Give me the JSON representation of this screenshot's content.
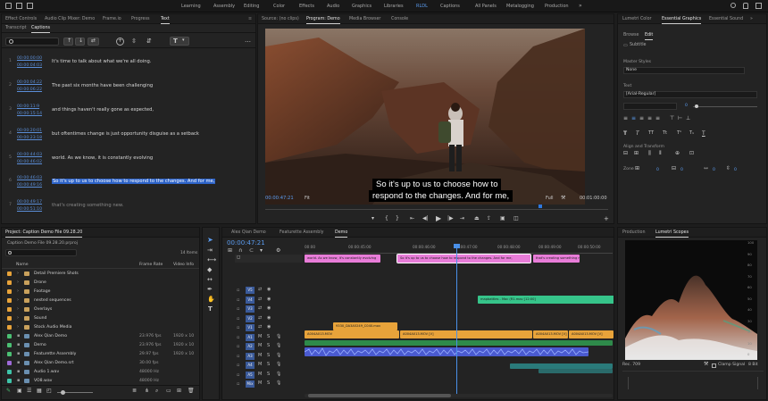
{
  "workspaces": {
    "items": [
      "Learning",
      "Assembly",
      "Editing",
      "Color",
      "Effects",
      "Audio",
      "Graphics",
      "Libraries",
      "RLDL",
      "Libraries",
      "Captions",
      "All Panels",
      "Metalogging",
      "Production"
    ],
    "active_index": 8
  },
  "text_panel": {
    "top_tabs": [
      "Effect Controls",
      "Audio Clip Mixer: Demo",
      "Frame.io",
      "Progress",
      "Text"
    ],
    "active_tab": "Text",
    "sub_tabs": [
      "Transcript",
      "Captions"
    ],
    "active_sub_tab": "Captions",
    "search_placeholder": "",
    "captions": [
      {
        "in": "00:00:00:00",
        "out": "00:00:04:03",
        "text": "It's time to talk about what we're all doing."
      },
      {
        "in": "00:00:04:22",
        "out": "00:00:06:22",
        "text": "The past six months have been challenging"
      },
      {
        "in": "00:00:11:9",
        "out": "00:00:15:14",
        "text": "and things haven't really gone as expected,"
      },
      {
        "in": "00:00:20:01",
        "out": "00:00:23:18",
        "text": "but oftentimes change is just opportunity disguise as a setback"
      },
      {
        "in": "00:00:44:03",
        "out": "00:00:46:02",
        "text": "world. As we know, it is constantly evolving"
      },
      {
        "in": "00:00:46:03",
        "out": "00:00:49:16",
        "text": "So it's up to us to choose how to respond to the changes. And for me,"
      },
      {
        "in": "00:00:49:17",
        "out": "00:00:51:10",
        "text": "that's creating something new."
      }
    ],
    "selected_index": 5
  },
  "source_panel": {
    "tabs": [
      "Source: (no clips)",
      "Program: Demo",
      "Media Browser",
      "Console"
    ],
    "active_tab": "Program: Demo",
    "timecode": "00:00:47:21",
    "fit": "Fit",
    "quality": "Full",
    "duration": "00:01:00:00",
    "caption_line1": "So it's up to us to choose how to",
    "caption_line2": "respond to the changes. And for me,"
  },
  "right_panel": {
    "tabs": [
      "Lumetri Color",
      "Essential Graphics",
      "Essential Sound"
    ],
    "active_tab": "Essential Graphics",
    "sub_tabs": [
      "Browse",
      "Edit"
    ],
    "active_sub_tab": "Edit",
    "layer_name": "Subtitle",
    "master_styles_label": "Master Styles",
    "master_style_value": "None",
    "text_label": "Text",
    "font_value": "[Arial-Regular]",
    "tracking_value": "0",
    "align_label": "Align and Transform",
    "zone_label": "Zone",
    "zone_x": "0",
    "zone_y": "0",
    "zone_w": "0",
    "zone_h": "0"
  },
  "project_panel": {
    "title": "Project: Caption Demo File 09.28.20",
    "file_name": "Caption Demo File 09.28.20.prproj",
    "item_count": "14 Items",
    "columns": [
      "Name",
      "Frame Rate",
      "Video Info"
    ],
    "items": [
      {
        "name": "Detail Premiere Shots",
        "rate": "",
        "info": "",
        "color": "#e8a33a"
      },
      {
        "name": "Drone",
        "rate": "",
        "info": "",
        "color": "#e8a33a"
      },
      {
        "name": "Footage",
        "rate": "",
        "info": "",
        "color": "#e8a33a"
      },
      {
        "name": "nested sequences",
        "rate": "",
        "info": "",
        "color": "#e8a33a"
      },
      {
        "name": "Overlays",
        "rate": "",
        "info": "",
        "color": "#e8a33a"
      },
      {
        "name": "Sound",
        "rate": "",
        "info": "",
        "color": "#e8a33a"
      },
      {
        "name": "Stock Audio Media",
        "rate": "",
        "info": "",
        "color": "#e8a33a"
      },
      {
        "name": "Alex Qian Demo",
        "rate": "23.976 fps",
        "info": "1920 x 10",
        "color": "#4bbf73"
      },
      {
        "name": "Demo",
        "rate": "23.976 fps",
        "info": "1920 x 10",
        "color": "#4bbf73"
      },
      {
        "name": "Featurette Assembly",
        "rate": "29.97 fps",
        "info": "1920 x 10",
        "color": "#4bbf73"
      },
      {
        "name": "Alex Qian Demo.srt",
        "rate": "30.00 fps",
        "info": "",
        "color": "#9e6ad8"
      },
      {
        "name": "Audio 1.wav",
        "rate": "48000 Hz",
        "info": "",
        "color": "#3ec3a8"
      },
      {
        "name": "VO8.wav",
        "rate": "48000 Hz",
        "info": "",
        "color": "#3ec3a8"
      }
    ]
  },
  "timeline": {
    "tabs": [
      "Alex Qian Demo",
      "Featurette Assembly",
      "Demo"
    ],
    "active_tab": "Demo",
    "timecode": "00:00:47:21",
    "ruler": [
      "00:00",
      "00:00:45:00",
      "00:00:46:00",
      "00:00:47:00",
      "00:00:48:00",
      "00:00:49:00",
      "00:00:50:00",
      "00:00:51:00"
    ],
    "caption_clips": [
      "world. As we know, it's constantly evolving",
      "So it's up to us to choose how to respond to the changes. And for me,",
      "that's creating something new"
    ],
    "v3_clip": "mapbattles - Mac (R1.mov [12:00]",
    "v2_clip": "9330_DA3A5249_C040.mov",
    "v1_clips": [
      "A004A013.MOV",
      "A004A013.MOV [V]",
      "A004A013.MOV [V]",
      "A004A013.MOV [V]",
      "A004A013.MOV [V]"
    ],
    "track_labels": [
      "V5",
      "V4",
      "V3",
      "V2",
      "V1",
      "A1",
      "A2",
      "A3",
      "A4",
      "A5",
      "Mix"
    ]
  },
  "scopes": {
    "tabs": [
      "Production",
      "Lumetri Scopes"
    ],
    "active_tab": "Lumetri Scopes",
    "axis_values": [
      "100",
      "90",
      "80",
      "70",
      "60",
      "50",
      "40",
      "30",
      "20",
      "10",
      "0"
    ],
    "footer_left": "Rec. 709",
    "footer_mid": "Clamp Signal",
    "footer_right": "8 Bit"
  },
  "colors": {
    "accent": "#2d78e0",
    "caption_clip": "#e87cd8",
    "video_clip": "#e8a33a",
    "audio_clip": "#5c6ee0",
    "green_clip": "#36c48a"
  }
}
